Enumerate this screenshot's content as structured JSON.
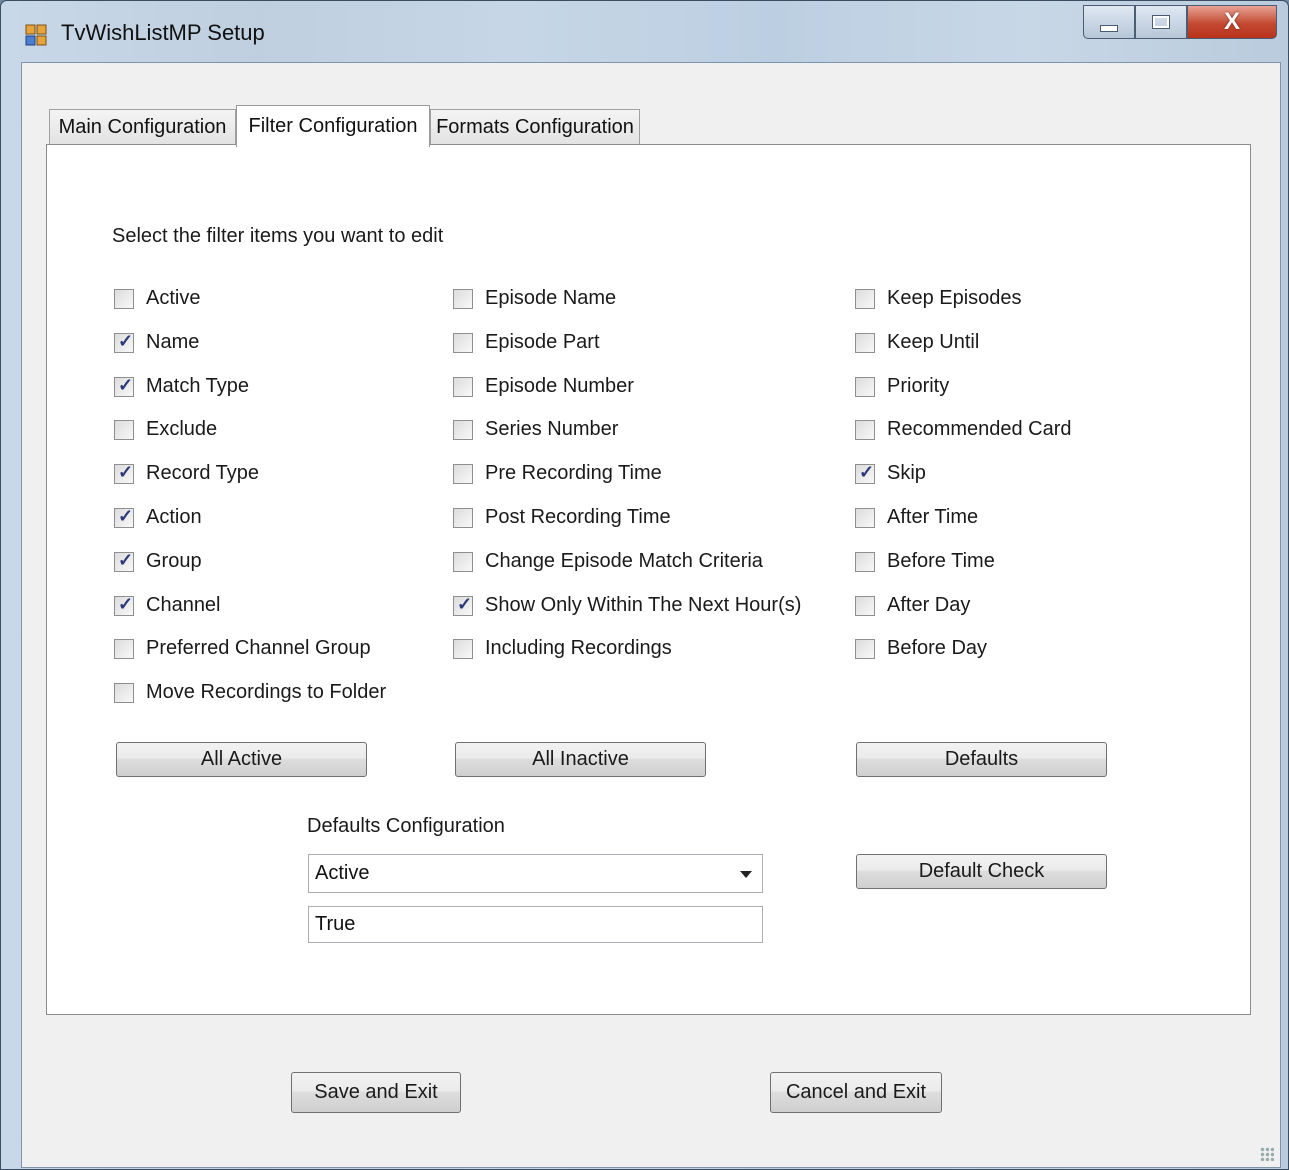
{
  "window": {
    "title": "TvWishListMP Setup",
    "close_glyph": "X"
  },
  "tabs": [
    {
      "label": "Main Configuration",
      "selected": false
    },
    {
      "label": "Filter Configuration",
      "selected": true
    },
    {
      "label": "Formats Configuration",
      "selected": false
    }
  ],
  "filter": {
    "instruction": "Select the filter items you want to edit",
    "column1": [
      {
        "label": "Active",
        "checked": false
      },
      {
        "label": "Name",
        "checked": true
      },
      {
        "label": "Match Type",
        "checked": true
      },
      {
        "label": "Exclude",
        "checked": false
      },
      {
        "label": "Record Type",
        "checked": true
      },
      {
        "label": "Action",
        "checked": true
      },
      {
        "label": "Group",
        "checked": true
      },
      {
        "label": "Channel",
        "checked": true
      },
      {
        "label": "Preferred Channel Group",
        "checked": false
      },
      {
        "label": "Move Recordings to Folder",
        "checked": false
      }
    ],
    "column2": [
      {
        "label": "Episode Name",
        "checked": false
      },
      {
        "label": "Episode Part",
        "checked": false
      },
      {
        "label": "Episode Number",
        "checked": false
      },
      {
        "label": "Series Number",
        "checked": false
      },
      {
        "label": "Pre Recording Time",
        "checked": false
      },
      {
        "label": "Post Recording Time",
        "checked": false
      },
      {
        "label": "Change Episode Match Criteria",
        "checked": false
      },
      {
        "label": "Show Only Within The Next Hour(s)",
        "checked": true
      },
      {
        "label": "Including Recordings",
        "checked": false
      }
    ],
    "column3": [
      {
        "label": "Keep Episodes",
        "checked": false
      },
      {
        "label": "Keep Until",
        "checked": false
      },
      {
        "label": "Priority",
        "checked": false
      },
      {
        "label": "Recommended Card",
        "checked": false
      },
      {
        "label": "Skip",
        "checked": true
      },
      {
        "label": "After Time",
        "checked": false
      },
      {
        "label": "Before Time",
        "checked": false
      },
      {
        "label": "After Day",
        "checked": false
      },
      {
        "label": "Before Day",
        "checked": false
      }
    ],
    "all_active_label": "All Active",
    "all_inactive_label": "All Inactive",
    "defaults_label": "Defaults"
  },
  "defaults_config": {
    "heading": "Defaults Configuration",
    "selected_item": "Active",
    "value": "True",
    "default_check_label": "Default Check"
  },
  "footer": {
    "save_label": "Save and Exit",
    "cancel_label": "Cancel and Exit"
  }
}
